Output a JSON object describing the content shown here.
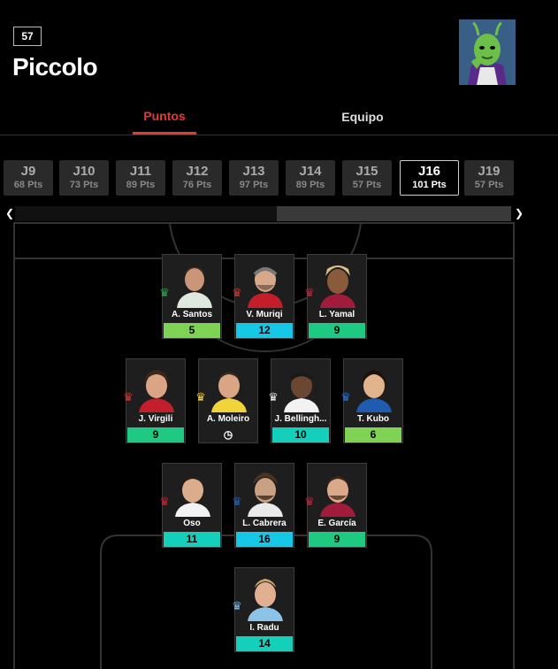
{
  "header": {
    "rank": "57",
    "team_name": "Piccolo",
    "avatar_icon": "piccolo-avatar-icon"
  },
  "tabs": [
    {
      "label": "Puntos",
      "active": true
    },
    {
      "label": "Equipo",
      "active": false
    }
  ],
  "rounds": [
    {
      "label": "J9",
      "points": "68 Pts"
    },
    {
      "label": "J10",
      "points": "73 Pts"
    },
    {
      "label": "J11",
      "points": "89 Pts"
    },
    {
      "label": "J12",
      "points": "76 Pts"
    },
    {
      "label": "J13",
      "points": "97 Pts"
    },
    {
      "label": "J14",
      "points": "89 Pts"
    },
    {
      "label": "J15",
      "points": "57 Pts"
    },
    {
      "label": "J16",
      "points": "101 Pts",
      "active": true
    },
    {
      "label": "J19",
      "points": "57 Pts"
    }
  ],
  "colors": {
    "accent": "#e63a2e",
    "points_lime": "#7fd354",
    "points_cyan": "#17c7e6",
    "points_green": "#1ec981",
    "points_teal": "#14cfb9"
  },
  "lineup": {
    "forwards": [
      {
        "name": "A. Santos",
        "points": "5",
        "club_icon": "betis-crest-icon",
        "color": "lime"
      },
      {
        "name": "V. Muriqi",
        "points": "12",
        "club_icon": "mallorca-crest-icon",
        "color": "cyan"
      },
      {
        "name": "L. Yamal",
        "points": "9",
        "club_icon": "barcelona-crest-icon",
        "color": "green"
      }
    ],
    "midfielders": [
      {
        "name": "J. Virgili",
        "points": "9",
        "club_icon": "mallorca-crest-icon",
        "color": "green"
      },
      {
        "name": "A. Moleiro",
        "points": "",
        "club_icon": "villarreal-crest-icon",
        "color": "pending",
        "status_icon": "clock-icon"
      },
      {
        "name": "J. Bellingh...",
        "points": "10",
        "club_icon": "real-madrid-crest-icon",
        "color": "teal"
      },
      {
        "name": "T. Kubo",
        "points": "6",
        "club_icon": "real-sociedad-crest-icon",
        "color": "lime"
      }
    ],
    "defenders": [
      {
        "name": "Oso",
        "points": "11",
        "club_icon": "sevilla-crest-icon",
        "color": "teal"
      },
      {
        "name": "L. Cabrera",
        "points": "16",
        "club_icon": "espanyol-crest-icon",
        "color": "cyan"
      },
      {
        "name": "E. García",
        "points": "9",
        "club_icon": "barcelona-crest-icon",
        "color": "green"
      }
    ],
    "goalkeeper": [
      {
        "name": "I. Radu",
        "points": "14",
        "club_icon": "celta-crest-icon",
        "color": "teal"
      }
    ]
  }
}
